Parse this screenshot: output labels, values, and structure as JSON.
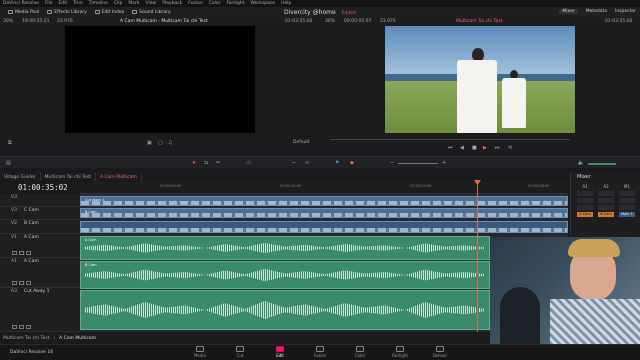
{
  "menu": [
    "DaVinci Resolve",
    "File",
    "Edit",
    "Trim",
    "Timeline",
    "Clip",
    "Mark",
    "View",
    "Playback",
    "Fusion",
    "Color",
    "Fairlight",
    "Workspace",
    "Help"
  ],
  "toolbar": {
    "left": [
      "Media Pool",
      "Effects Library",
      "Edit Index",
      "Sound Library"
    ],
    "project": "Divercity @home",
    "edited": "Edited",
    "right": [
      "Mixer",
      "Metadata",
      "Inspector"
    ]
  },
  "viewers": {
    "src_zoom": "30%",
    "src_tc": "19:40:55:21",
    "src_fps": "23.976",
    "src_title": "A Cam Multicam - Multicam Tai chi Test",
    "src_tc_right": "01:03:35:02",
    "rec_zoom": "30%",
    "rec_dur": "00:05:05:07",
    "rec_fps": "23.976",
    "rec_title": "Multicam Tai chi Test",
    "rec_tc": "01:03:35:02",
    "default_label": "Default"
  },
  "tabs": [
    "Village Guider",
    "Multicam Tai chi Test",
    "A Cam Multicam"
  ],
  "timecode": "01:00:35:02",
  "ruler": [
    "01:03:04:00",
    "01:03:12:00",
    "01:03:20:00",
    "01:03:28:00"
  ],
  "tracks": [
    {
      "id": "V3",
      "name": "C Cam"
    },
    {
      "id": "V2",
      "name": "B Cam"
    },
    {
      "id": "V1",
      "name": "A Cam"
    },
    {
      "id": "A1",
      "name": "A Cam"
    },
    {
      "id": "A2",
      "name": "B Cam"
    },
    {
      "id": "A3",
      "name": "Cut Away 1"
    }
  ],
  "clips": {
    "v3": "Cut Away 1",
    "v2": "B Cam",
    "a1": "A Cam",
    "a2": "B Cam"
  },
  "mixer": {
    "title": "Mixer",
    "channels": [
      "A1",
      "A2",
      "M1"
    ],
    "strips": [
      "A Cam",
      "B Cam",
      "Main 1"
    ]
  },
  "breadcrumb": [
    "Multicam Tai chi Test",
    "A Cam Multicam"
  ],
  "bottom_tabs": [
    "Media",
    "Cut",
    "Edit",
    "Fusion",
    "Color",
    "Fairlight",
    "Deliver"
  ],
  "active_tab": "Edit",
  "app_badge": "DaVinci Resolve 16"
}
